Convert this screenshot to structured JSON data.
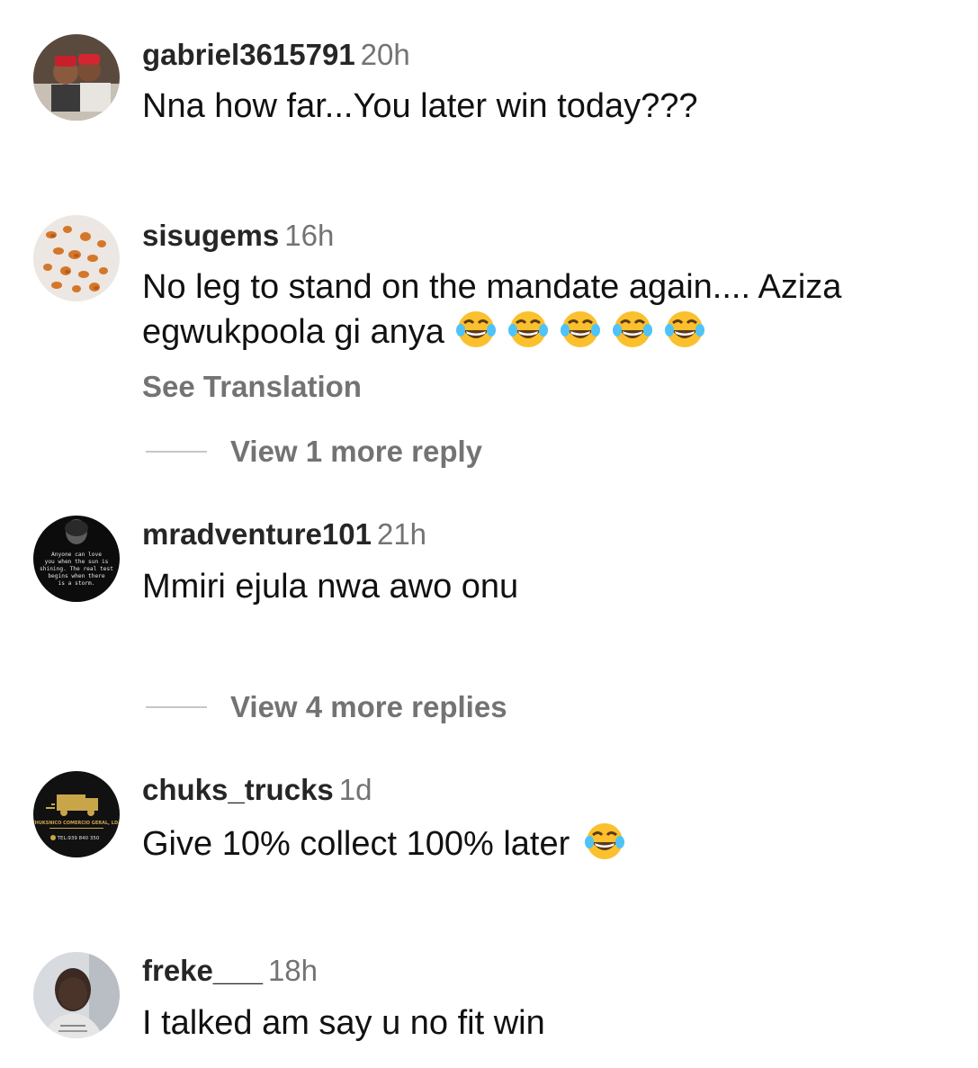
{
  "comments": [
    {
      "username": "gabriel3615791",
      "time": "20h",
      "text": "Nna how far...You later win today???",
      "avatar_icon": "photo-two-men-red-caps"
    },
    {
      "username": "sisugems",
      "time": "16h",
      "text_line1": "No leg to stand on the mandate again.... Aziza",
      "text_line2": "egwukpoola gi anya",
      "emoji_icon": "face-with-tears-of-joy",
      "emoji_count": 5,
      "see_translation": "See Translation",
      "view_replies": "View 1 more reply",
      "avatar_icon": "photo-orange-gems"
    },
    {
      "username": "mradventure101",
      "time": "21h",
      "text": "Mmiri ejula nwa awo onu",
      "view_replies": "View 4 more replies",
      "avatar_icon": "quote-portrait-dark",
      "avatar_text": "Anyone can love you when the sun is shining. The real test begins when there is a storm."
    },
    {
      "username": "chuks_trucks",
      "time": "1d",
      "text": "Give 10% collect 100% later",
      "emoji_icon": "face-with-tears-of-joy",
      "avatar_icon": "truck-logo-gold",
      "avatar_text_line1": "CHUKSNICO COMERCIO GERAL, LDA",
      "avatar_text_line2": "TEL:939 840 350"
    },
    {
      "username": "freke___",
      "time": "18h",
      "text": "I talked am say u no fit win",
      "avatar_icon": "photo-man-portrait"
    }
  ],
  "colors": {
    "username": "#262626",
    "secondary": "#737373",
    "divider": "#c7c7c7",
    "emoji_face": "#fbc02d"
  }
}
